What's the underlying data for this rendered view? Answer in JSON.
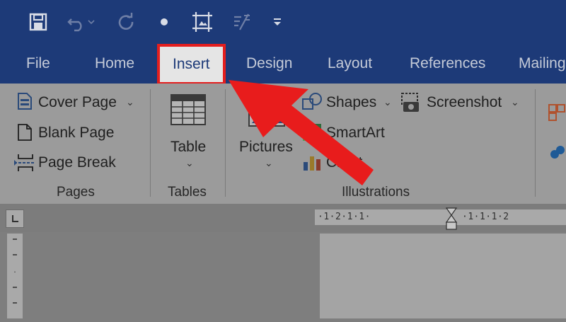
{
  "tabs": [
    "File",
    "Home",
    "Insert",
    "Design",
    "Layout",
    "References",
    "Mailing"
  ],
  "active_tab": "Insert",
  "pages_group": {
    "items": [
      "Cover Page",
      "Blank Page",
      "Page Break"
    ],
    "label": "Pages"
  },
  "tables_group": {
    "button": "Table",
    "label": "Tables"
  },
  "illustrations_group": {
    "pictures": "Pictures",
    "shapes": "Shapes",
    "smartart": "SmartArt",
    "chart": "Chart",
    "screenshot": "Screenshot",
    "label": "Illustrations"
  },
  "ruler": {
    "horizontal_left": "·1·2·1·1·",
    "horizontal_right": "·1·1·1·2"
  },
  "colors": {
    "title_bar": "#1d3a78",
    "ribbon": "#9b9b9b",
    "highlight": "#e31e1e"
  },
  "icons": [
    "save-icon",
    "undo-icon",
    "redo-icon",
    "bullet-icon",
    "select-icon",
    "form-icon",
    "customize-qat-icon"
  ]
}
